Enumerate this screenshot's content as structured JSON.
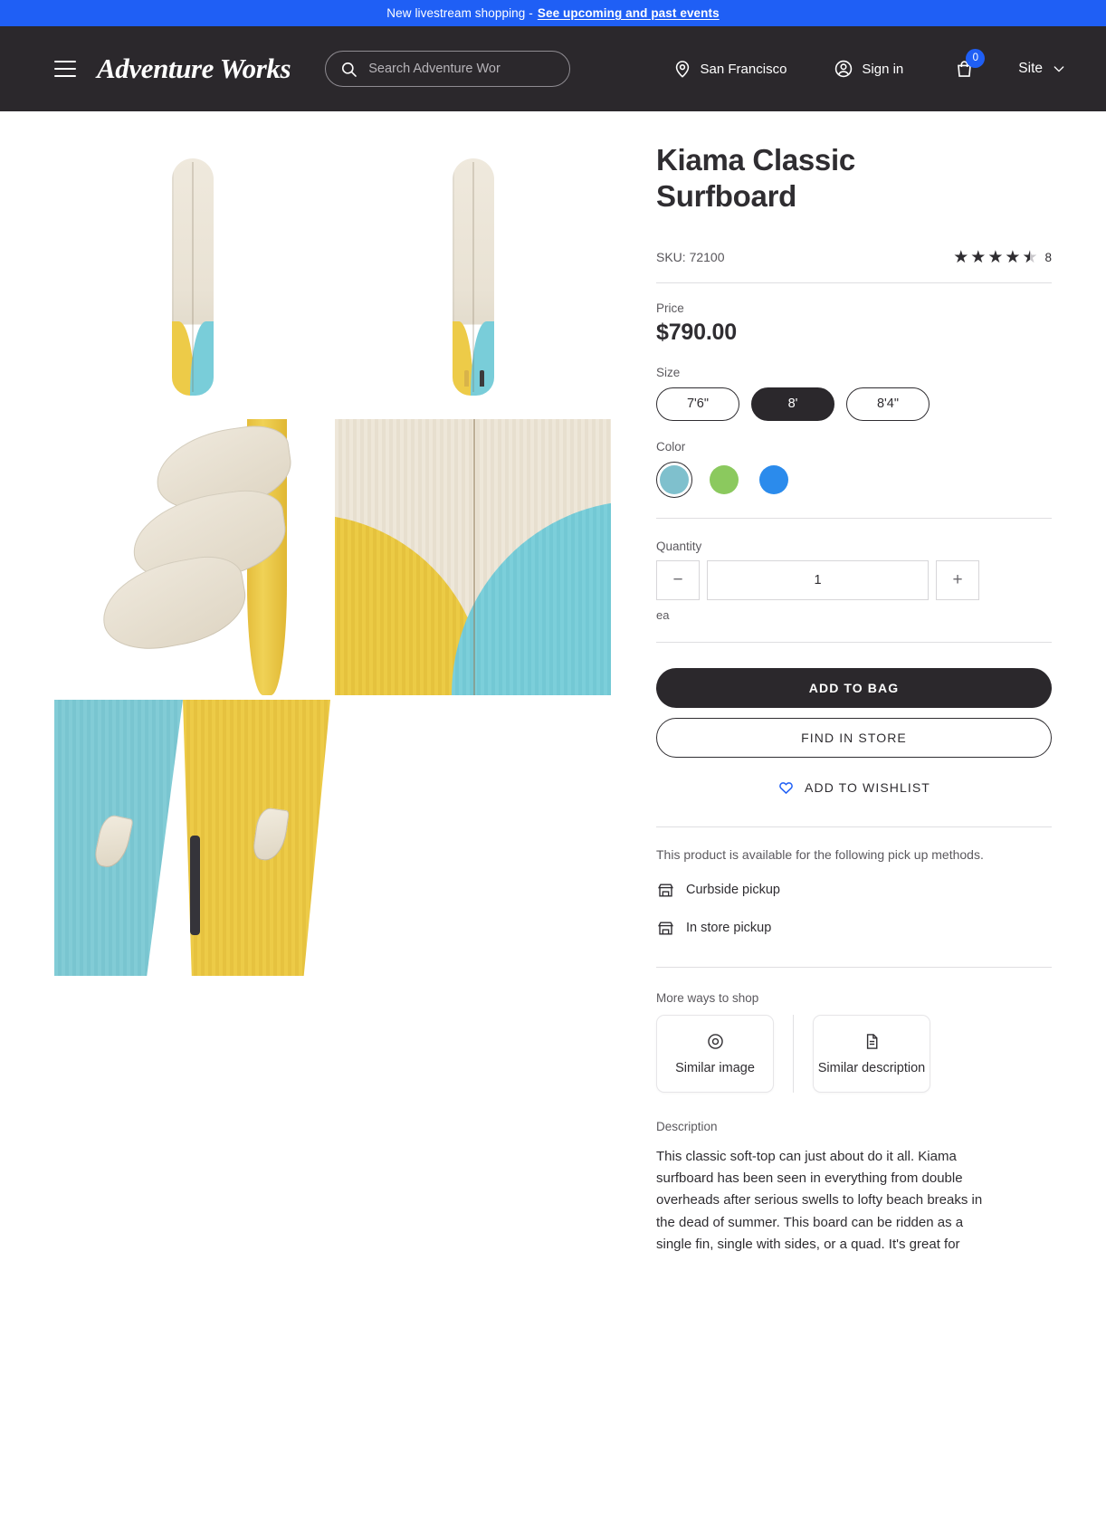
{
  "announcement": {
    "text": "New livestream shopping -",
    "link_label": "See upcoming and past events"
  },
  "header": {
    "menu_icon": "hamburger-icon",
    "brand": "Adventure Works",
    "search": {
      "placeholder": "Search Adventure Wor",
      "value": ""
    },
    "location": {
      "icon": "location-pin-icon",
      "label": "San Francisco"
    },
    "account": {
      "icon": "user-circle-icon",
      "label": "Sign in"
    },
    "bag": {
      "icon": "shopping-bag-icon",
      "count": "0"
    },
    "site": {
      "label": "Site",
      "icon": "chevron-down-icon"
    }
  },
  "product": {
    "title": "Kiama Classic Surfboard",
    "sku_label": "SKU: 72100",
    "rating": {
      "value": 4.5,
      "full_stars": 4,
      "has_half": true,
      "count": "8"
    },
    "price_label": "Price",
    "price": "$790.00",
    "size": {
      "label": "Size",
      "options": [
        "7'6\"",
        "8'",
        "8'4\""
      ],
      "selected": "8'"
    },
    "color": {
      "label": "Color",
      "options": [
        {
          "name": "teal",
          "hex": "#7fc0cd",
          "selected": true
        },
        {
          "name": "green",
          "hex": "#8bc95e",
          "selected": false
        },
        {
          "name": "blue",
          "hex": "#2b8bec",
          "selected": false
        }
      ]
    },
    "quantity": {
      "label": "Quantity",
      "decrement_icon": "minus-icon",
      "increment_icon": "plus-icon",
      "value": "1",
      "uom": "ea"
    },
    "actions": {
      "add_to_bag": "ADD TO BAG",
      "find_in_store": "FIND IN STORE",
      "wishlist": "ADD TO WISHLIST",
      "wishlist_icon": "heart-icon"
    },
    "pickup": {
      "note": "This product is available for the following pick up methods.",
      "methods": [
        {
          "icon": "storefront-icon",
          "label": "Curbside pickup"
        },
        {
          "icon": "storefront-icon",
          "label": "In store pickup"
        }
      ]
    },
    "more_ways": {
      "label": "More ways to shop",
      "cards": [
        {
          "icon": "eye-icon",
          "label": "Similar image"
        },
        {
          "icon": "document-icon",
          "label": "Similar description"
        }
      ]
    },
    "description": {
      "label": "Description",
      "body": "This classic soft-top can just about do it all. Kiama surfboard has been seen in everything from double overheads after serious swells to lofty beach breaks in the dead of summer. This board can be ridden as a single fin, single with sides, or a quad. It's great for"
    }
  },
  "colors": {
    "accent": "#1f5ff5",
    "dark": "#2b282c",
    "board_wood": "#e9e2d4",
    "board_yellow": "#edcb48",
    "board_cyan": "#79cdd9"
  }
}
